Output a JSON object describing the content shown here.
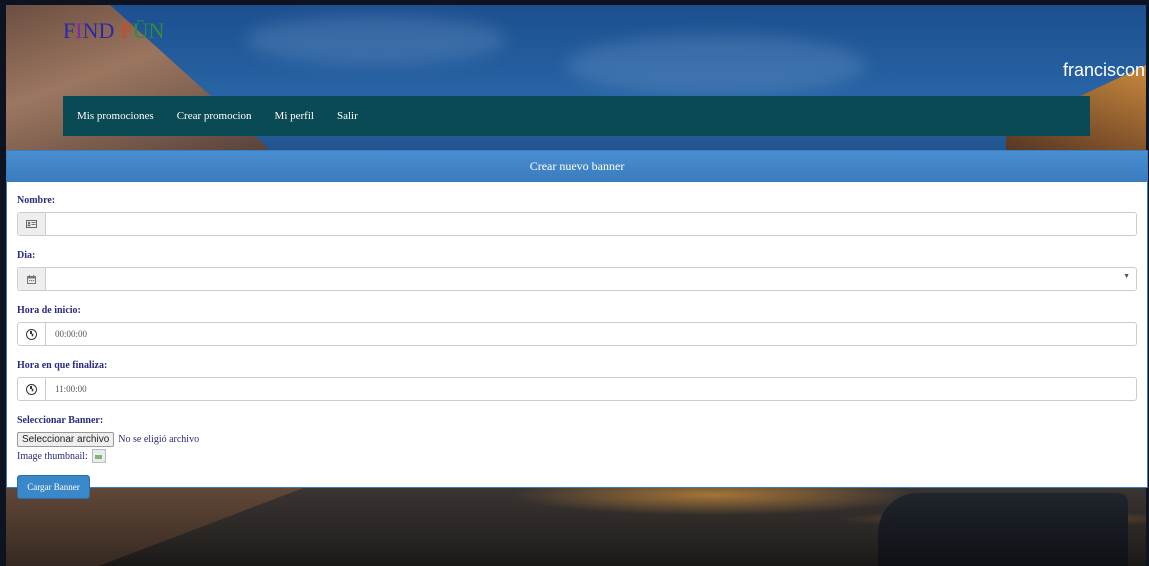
{
  "brand": {
    "logo_letters": [
      "F",
      "I",
      "N",
      "D",
      "F",
      "Ü",
      "N"
    ]
  },
  "header": {
    "username": "franciscon"
  },
  "nav": {
    "items": [
      {
        "label": "Mis promociones"
      },
      {
        "label": "Crear promocion"
      },
      {
        "label": "Mi perfil"
      },
      {
        "label": "Salir"
      }
    ]
  },
  "panel": {
    "title": "Crear nuevo banner",
    "fields": {
      "nombre": {
        "label": "Nombre:",
        "value": "",
        "icon": "id-card-icon"
      },
      "dia": {
        "label": "Dia:",
        "value": "",
        "icon": "calendar-icon"
      },
      "hora_inicio": {
        "label": "Hora de inicio:",
        "value": "00:00:00",
        "icon": "clock-icon"
      },
      "hora_fin": {
        "label": "Hora en que finaliza:",
        "value": "11:00:00",
        "icon": "clock-icon"
      }
    },
    "banner": {
      "label": "Seleccionar Banner:",
      "file_button": "Seleccionar archivo",
      "file_status": "No se eligió archivo",
      "thumbnail_label": "Image thumbnail:"
    },
    "submit_label": "Cargar Banner"
  },
  "colors": {
    "nav_bg": "#0a4a55",
    "panel_heading": "#3a7cbd",
    "label_text": "#2a2a7e",
    "submit_bg": "#3a87c9"
  }
}
